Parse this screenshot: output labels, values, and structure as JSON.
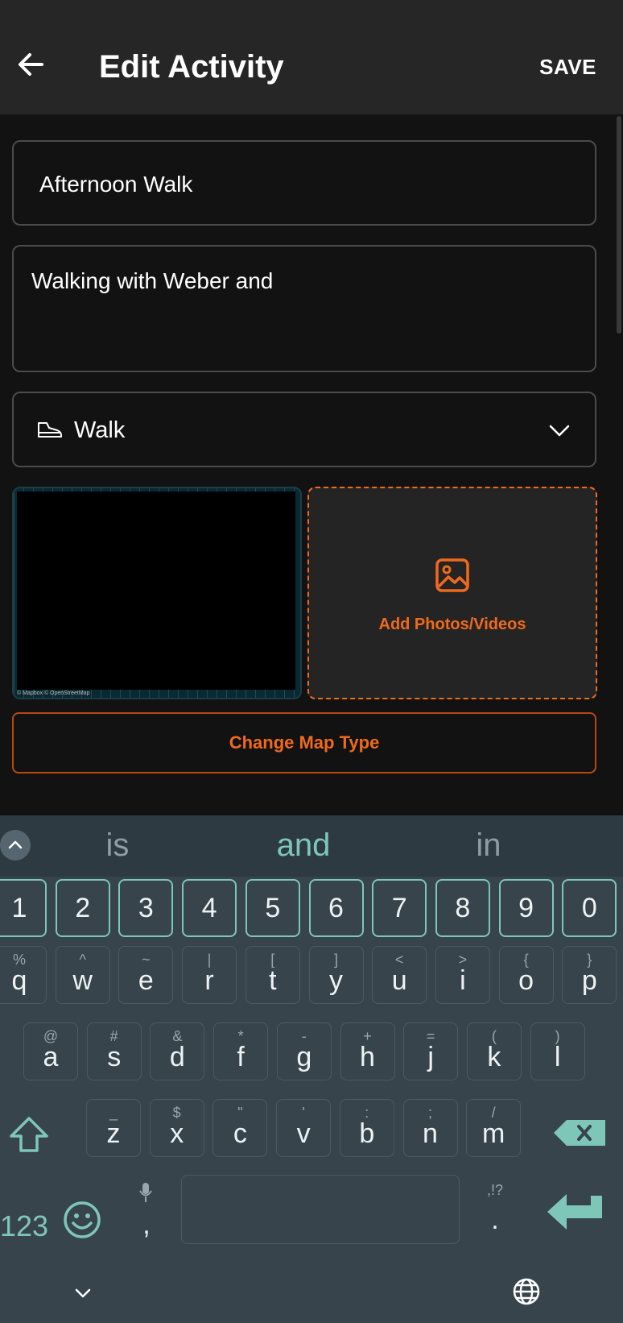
{
  "appbar": {
    "title": "Edit Activity",
    "save_label": "SAVE"
  },
  "form": {
    "name_value": "Afternoon Walk",
    "description_value": "Walking with Weber and",
    "sport_type": "Walk",
    "map_credit": "© Mapbox © OpenStreetMap",
    "add_media_label": "Add Photos/Videos",
    "change_map_label": "Change Map Type"
  },
  "keyboard": {
    "suggestions": [
      "is",
      "and",
      "in"
    ],
    "number_row": [
      "1",
      "2",
      "3",
      "4",
      "5",
      "6",
      "7",
      "8",
      "9",
      "0"
    ],
    "row1": [
      [
        "%",
        "q"
      ],
      [
        "^",
        "w"
      ],
      [
        "~",
        "e"
      ],
      [
        "|",
        "r"
      ],
      [
        "[",
        "t"
      ],
      [
        "]",
        "y"
      ],
      [
        "<",
        "u"
      ],
      [
        ">",
        "i"
      ],
      [
        "{",
        "o"
      ],
      [
        "}",
        "p"
      ]
    ],
    "row2": [
      [
        "@",
        "a"
      ],
      [
        "#",
        "s"
      ],
      [
        "&",
        "d"
      ],
      [
        "*",
        "f"
      ],
      [
        "-",
        "g"
      ],
      [
        "+",
        "h"
      ],
      [
        "=",
        "j"
      ],
      [
        "(",
        "k"
      ],
      [
        ")",
        "l"
      ]
    ],
    "row3": [
      [
        "_",
        "z"
      ],
      [
        "$",
        "x"
      ],
      [
        "\"",
        "c"
      ],
      [
        "'",
        "v"
      ],
      [
        ":",
        "b"
      ],
      [
        ";",
        "n"
      ],
      [
        "/",
        "m"
      ]
    ],
    "symbols_label": "123",
    "comma_label": ",",
    "period_label": ".",
    "period_alt": ",!?"
  },
  "colors": {
    "accent": "#f06a1d",
    "keyboard_accent": "#7ec6b8",
    "appbar": "#262626",
    "keyboard_bg": "#37444c"
  }
}
